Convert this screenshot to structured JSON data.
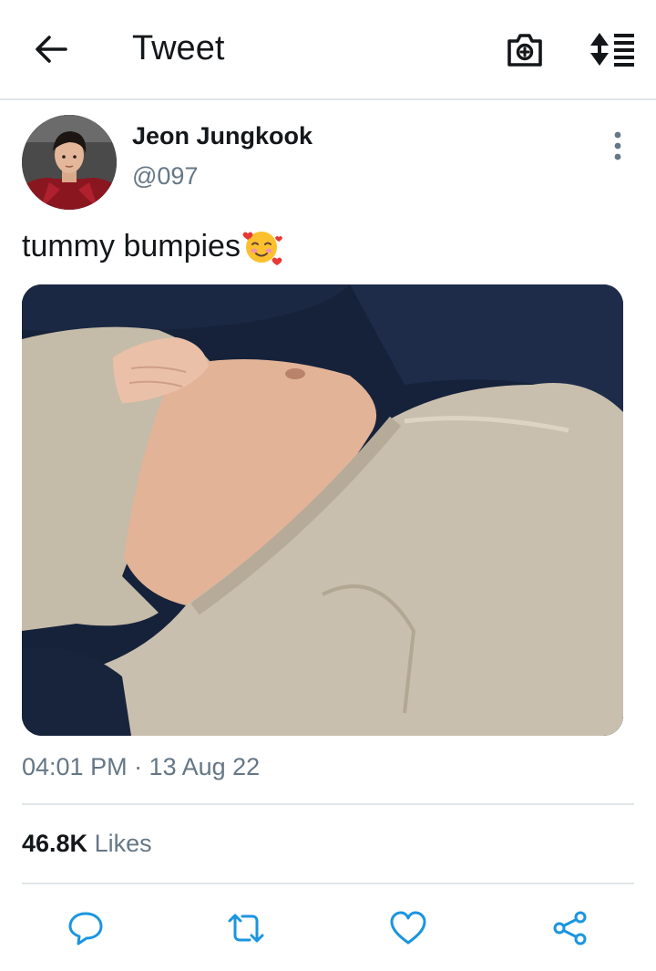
{
  "header": {
    "title": "Tweet",
    "back_icon": "arrow-left-icon",
    "camera_icon": "camera-add-icon",
    "sort_icon": "sort-list-icon"
  },
  "tweet": {
    "author_name": "Jeon Jungkook",
    "author_handle": "@097",
    "text": "tummy bumpies",
    "emoji": "smiling-face-with-hearts",
    "timestamp": "04:01 PM · 13 Aug 22",
    "likes_count": "46.8K",
    "likes_label": "Likes"
  },
  "actions": [
    {
      "icon": "reply-icon"
    },
    {
      "icon": "retweet-icon"
    },
    {
      "icon": "like-icon"
    },
    {
      "icon": "share-icon"
    }
  ],
  "colors": {
    "text": "#14171a",
    "secondary_text": "#657786",
    "divider": "#e1e5e8",
    "icon_blue": "#1b95e0"
  }
}
